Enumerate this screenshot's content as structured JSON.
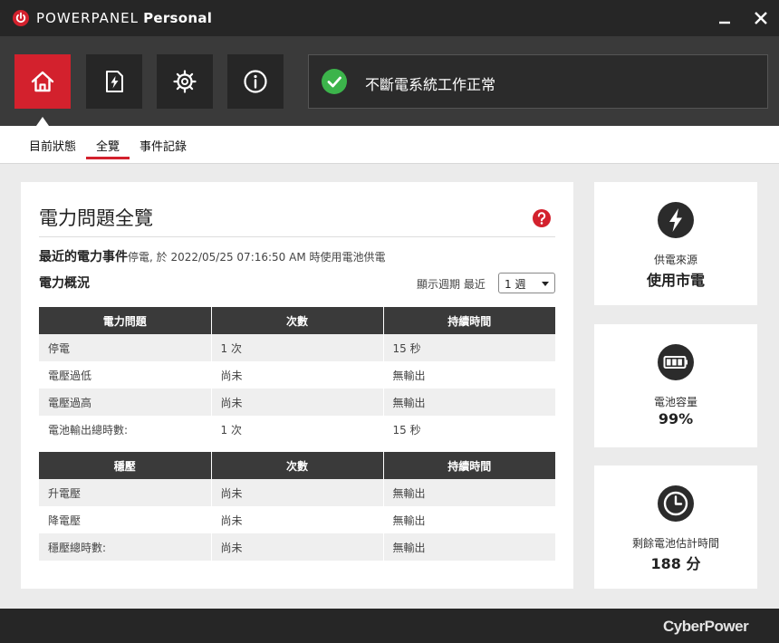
{
  "titlebar": {
    "brand_light": "POWER",
    "brand_mid": "PANEL",
    "brand_bold": "Personal",
    "accent_color": "#d3212d"
  },
  "nav": [
    {
      "icon": "home-icon",
      "active": true
    },
    {
      "icon": "power-event-icon",
      "active": false
    },
    {
      "icon": "gear-icon",
      "active": false
    },
    {
      "icon": "info-icon",
      "active": false
    }
  ],
  "status": {
    "icon": "check-circle-icon",
    "text": "不斷電系統工作正常",
    "color": "#3cb44b"
  },
  "tabs": [
    {
      "label": "目前狀態",
      "active": false
    },
    {
      "label": "全覽",
      "active": true
    },
    {
      "label": "事件記錄",
      "active": false
    }
  ],
  "main": {
    "title": "電力問題全覽",
    "recent_event_label": "最近的電力事件",
    "recent_event_value": "停電, 於 2022/05/25 07:16:50 AM 時使用電池供電",
    "overview_label": "電力概況",
    "period_label": "顯示週期 最近",
    "period_value": "1 週",
    "power_table": {
      "headers": [
        "電力問題",
        "次數",
        "持續時間"
      ],
      "rows": [
        [
          "停電",
          "1 次",
          "15 秒"
        ],
        [
          "電壓過低",
          "尚未",
          "無輸出"
        ],
        [
          "電壓過高",
          "尚未",
          "無輸出"
        ],
        [
          "電池輸出總時數:",
          "1 次",
          "15 秒"
        ]
      ]
    },
    "avr_table": {
      "headers": [
        "穩壓",
        "次數",
        "持續時間"
      ],
      "rows": [
        [
          "升電壓",
          "尚未",
          "無輸出"
        ],
        [
          "降電壓",
          "尚未",
          "無輸出"
        ],
        [
          "穩壓總時數:",
          "尚未",
          "無輸出"
        ]
      ]
    }
  },
  "side": {
    "source": {
      "icon": "lightning-bolt-icon",
      "label": "供電來源",
      "value": "使用市電"
    },
    "battery": {
      "icon": "battery-icon",
      "label": "電池容量",
      "value": "99%"
    },
    "runtime": {
      "icon": "clock-icon",
      "label": "剩餘電池估計時間",
      "value": "188 分"
    }
  },
  "footer": {
    "brand": "CyberPower"
  }
}
